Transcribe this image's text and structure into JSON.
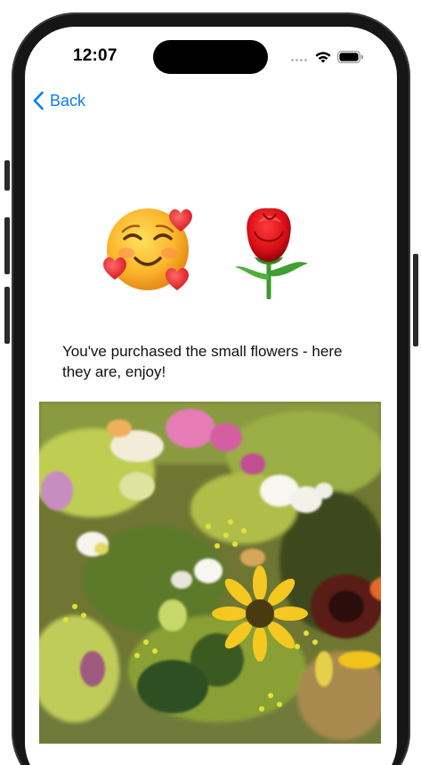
{
  "status_bar": {
    "time": "12:07"
  },
  "nav": {
    "back_label": "Back"
  },
  "content": {
    "emojis": [
      {
        "name": "smiling-face-with-hearts",
        "glyph": "🥰"
      },
      {
        "name": "rose",
        "glyph": "🌹"
      }
    ],
    "message": "You've purchased the small flowers - here they are, enjoy!"
  },
  "colors": {
    "accent": "#0A7AFF",
    "text": "#111111",
    "background": "#FFFFFF",
    "frame": "#161616"
  },
  "icons": [
    "chevron-left-icon",
    "wifi-icon",
    "battery-icon",
    "cellular-signal-icon"
  ]
}
